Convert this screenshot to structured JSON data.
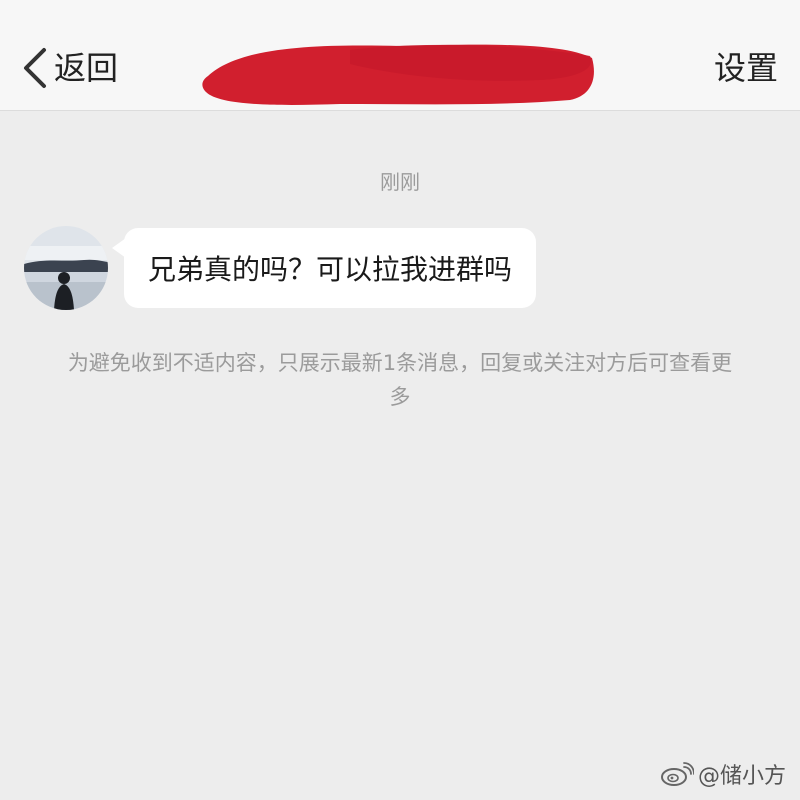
{
  "navbar": {
    "back_label": "返回",
    "title_redaction_color": "#d11f2e",
    "settings_label": "设置"
  },
  "chat": {
    "timestamp": "刚刚",
    "messages": [
      {
        "text": "兄弟真的吗？可以拉我进群吗"
      }
    ],
    "notice": "为避免收到不适内容，只展示最新1条消息，回复或关注对方后可查看更多"
  },
  "watermark": {
    "text": "@储小方",
    "icon": "weibo-icon"
  }
}
